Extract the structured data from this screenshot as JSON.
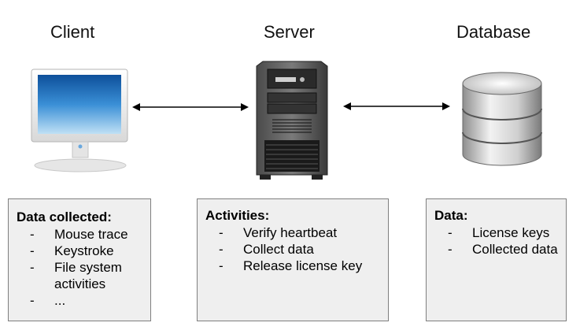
{
  "columns": {
    "client": {
      "title": "Client",
      "box": {
        "heading": "Data collected:",
        "items": [
          "Mouse trace",
          "Keystroke",
          "File system activities",
          "..."
        ]
      }
    },
    "server": {
      "title": "Server",
      "box": {
        "heading": "Activities:",
        "items": [
          "Verify heartbeat",
          "Collect data",
          "Release license key"
        ]
      }
    },
    "database": {
      "title": "Database",
      "box": {
        "heading": "Data:",
        "items": [
          "License keys",
          "Collected data"
        ]
      }
    }
  },
  "icons": {
    "client": "monitor-icon",
    "server": "server-tower-icon",
    "database": "database-icon"
  },
  "colors": {
    "box_fill": "#efefef",
    "box_border": "#7f7f7f",
    "screen_blue": "#1f6bb4"
  }
}
